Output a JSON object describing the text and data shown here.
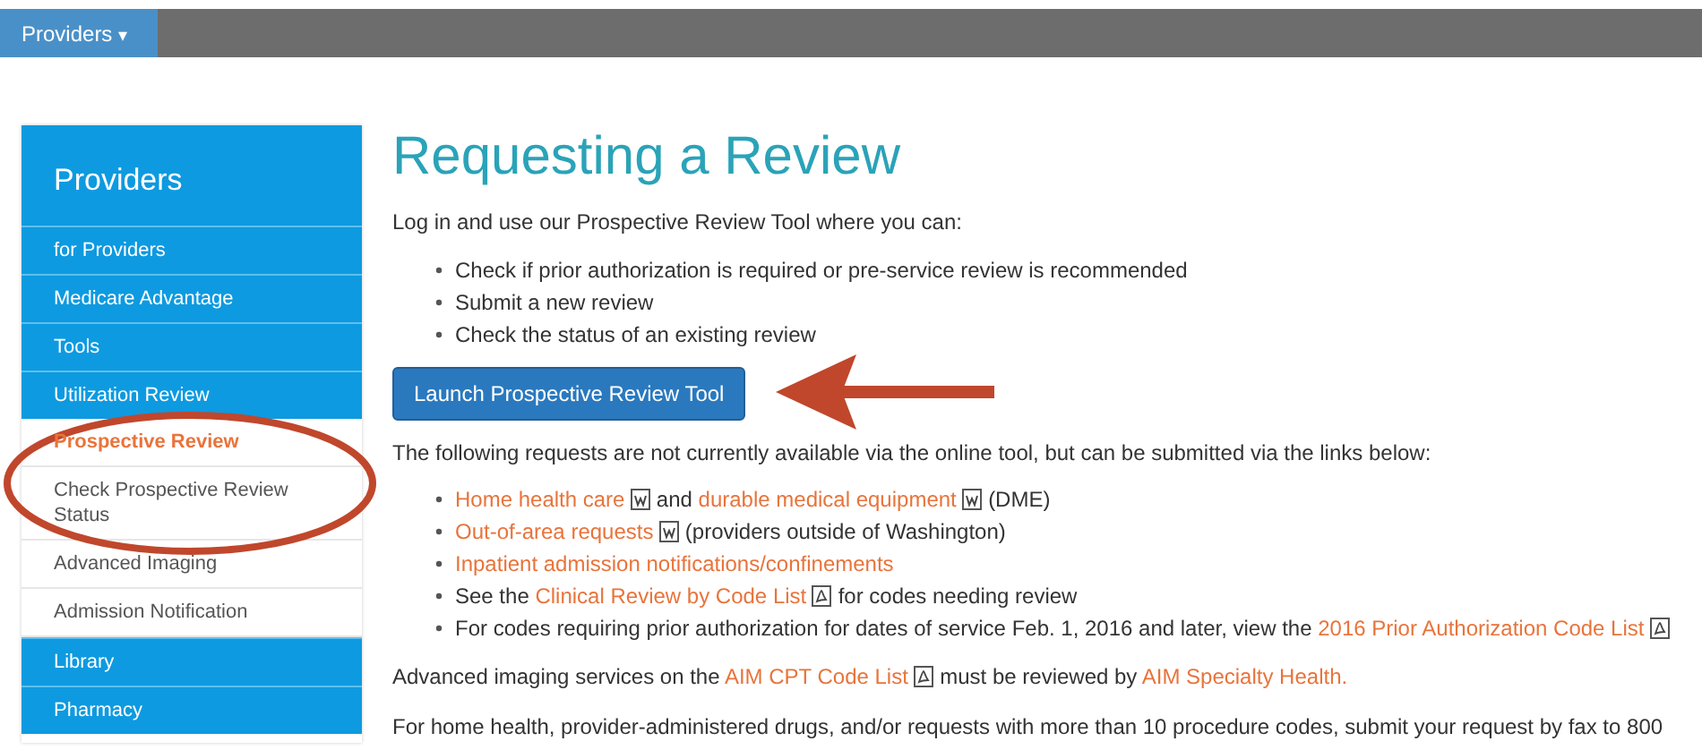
{
  "top_bar": {
    "menu_label": "Providers",
    "caret": "▾"
  },
  "sidebar": {
    "title": "Providers",
    "items": [
      {
        "label": "for Providers",
        "kind": "section",
        "selected": false
      },
      {
        "label": "Medicare Advantage",
        "kind": "section",
        "selected": false
      },
      {
        "label": "Tools",
        "kind": "section",
        "selected": false
      },
      {
        "label": "Utilization Review",
        "kind": "section",
        "selected": false
      },
      {
        "label": "Prospective Review",
        "kind": "sub",
        "selected": true
      },
      {
        "label": "Check Prospective Review Status",
        "kind": "sub",
        "selected": false
      },
      {
        "label": "Advanced Imaging",
        "kind": "sub",
        "selected": false
      },
      {
        "label": "Admission Notification",
        "kind": "sub",
        "selected": false
      },
      {
        "label": "Library",
        "kind": "section",
        "selected": false
      },
      {
        "label": "Pharmacy",
        "kind": "section",
        "selected": false
      }
    ]
  },
  "main": {
    "title": "Requesting a Review",
    "intro": "Log in and use our Prospective Review Tool where you can:",
    "tool_features": [
      "Check if prior authorization is required or pre-service review is recommended",
      "Submit a new review",
      "Check the status of an existing review"
    ],
    "launch_button": "Launch Prospective Review Tool",
    "requests_intro": "The following requests are not currently available via the online tool, but can be submitted via the links below:",
    "requests": [
      [
        {
          "kind": "link",
          "text": "Home health care"
        },
        {
          "kind": "word-icon"
        },
        {
          "kind": "text",
          "text": "and"
        },
        {
          "kind": "link",
          "text": "durable medical equipment"
        },
        {
          "kind": "word-icon"
        },
        {
          "kind": "text",
          "text": "(DME)"
        }
      ],
      [
        {
          "kind": "link",
          "text": "Out-of-area requests"
        },
        {
          "kind": "word-icon"
        },
        {
          "kind": "text",
          "text": "(providers outside of Washington)"
        }
      ],
      [
        {
          "kind": "link",
          "text": "Inpatient admission notifications/confinements"
        }
      ],
      [
        {
          "kind": "text",
          "text": "See the"
        },
        {
          "kind": "link",
          "text": "Clinical Review by Code List"
        },
        {
          "kind": "pdf-icon"
        },
        {
          "kind": "text",
          "text": "for codes needing review"
        }
      ],
      [
        {
          "kind": "text",
          "text": "For codes requiring prior authorization for dates of service Feb. 1, 2016 and later, view the"
        },
        {
          "kind": "link",
          "text": "2016 Prior Authorization Code List"
        },
        {
          "kind": "pdf-icon"
        }
      ]
    ],
    "imaging": [
      {
        "kind": "text",
        "text": "Advanced imaging services on the"
      },
      {
        "kind": "link",
        "text": "AIM CPT Code List"
      },
      {
        "kind": "pdf-icon"
      },
      {
        "kind": "text",
        "text": "must be reviewed by"
      },
      {
        "kind": "link",
        "text": "AIM Specialty Health."
      }
    ],
    "fax_note": "For home health, provider-administered drugs, and/or requests with more than 10 procedure codes, submit your request by fax to 800"
  },
  "annotations": {
    "arrow": true,
    "ellipse": true
  }
}
